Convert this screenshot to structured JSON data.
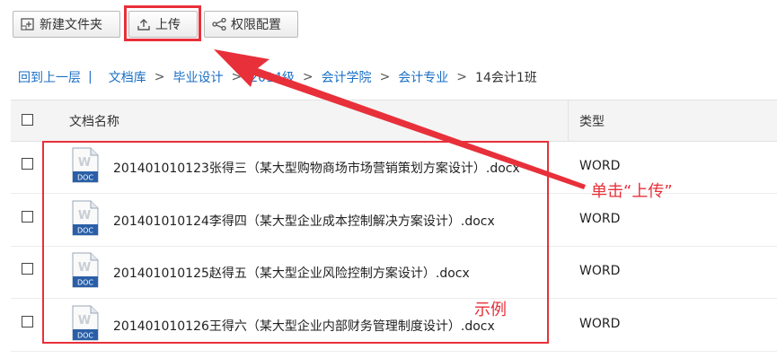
{
  "toolbar": {
    "new_folder": "新建文件夹",
    "upload": "上传",
    "permissions": "权限配置"
  },
  "breadcrumb": {
    "back": "回到上一层",
    "pipe": "|",
    "items": [
      "文档库",
      "毕业设计",
      "2014级",
      "会计学院",
      "会计专业"
    ],
    "separator": ">",
    "current": "14会计1班"
  },
  "table": {
    "header_name": "文档名称",
    "header_type": "类型",
    "rows": [
      {
        "name": "201401010123张得三（某大型购物商场市场营销策划方案设计）.docx",
        "type": "WORD"
      },
      {
        "name": "201401010124李得四（某大型企业成本控制解决方案设计）.docx",
        "type": "WORD"
      },
      {
        "name": "201401010125赵得五（某大型企业风险控制方案设计）.docx",
        "type": "WORD"
      },
      {
        "name": "201401010126王得六（某大型企业内部财务管理制度设计）.docx",
        "type": "WORD"
      }
    ]
  },
  "icon": {
    "letter": "W",
    "label": "DOC",
    "name": "word-doc-icon"
  },
  "annotations": {
    "click_upload": "单击“上传”",
    "example": "示例",
    "color": "#e8303a"
  },
  "colors": {
    "link": "#1a6fc4",
    "accent_red": "#e8303a",
    "doc_blue": "#2a5fa8"
  }
}
